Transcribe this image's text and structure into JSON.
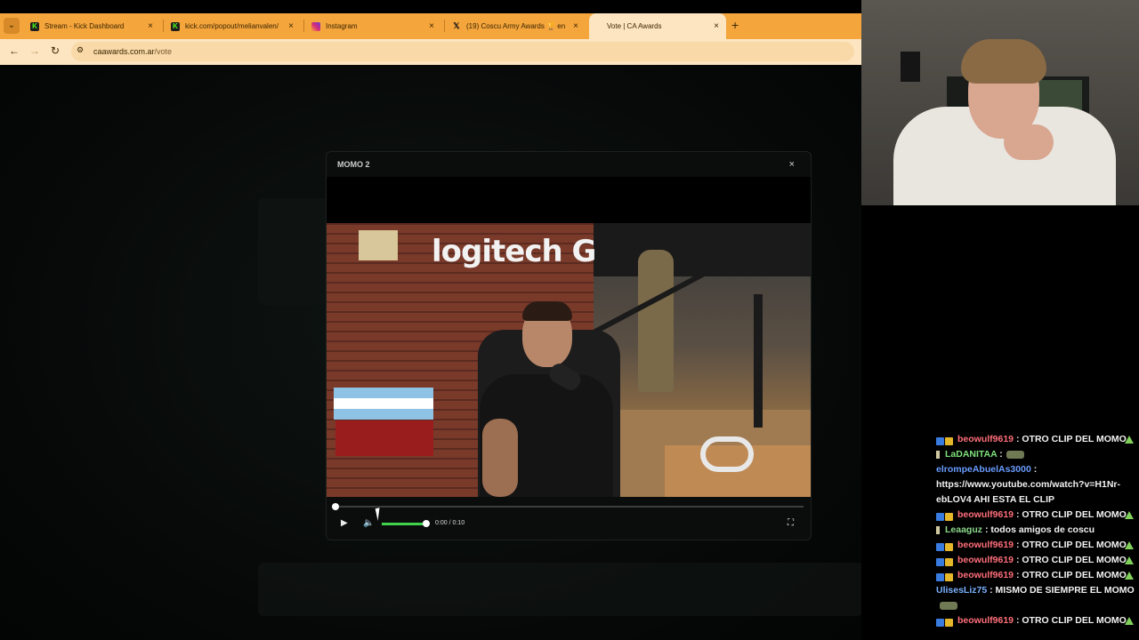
{
  "browser": {
    "tabs": [
      {
        "label": "Stream - Kick Dashboard",
        "favicon": "kick-icon",
        "active": false
      },
      {
        "label": "kick.com/popout/melianvalen/",
        "favicon": "kick-icon",
        "active": false
      },
      {
        "label": "Instagram",
        "favicon": "instagram-icon",
        "active": false
      },
      {
        "label": "(19) Coscu Army Awards 🏆 en",
        "favicon": "x-icon",
        "active": false
      },
      {
        "label": "Vote | CA Awards",
        "favicon": "",
        "active": true
      }
    ],
    "close_glyph": "×",
    "newtab_glyph": "+",
    "menu_glyph": "⌄",
    "url_domain": "caawards.com.ar",
    "url_path": "/vote",
    "nav": {
      "back": "←",
      "forward": "→",
      "reload": "↻",
      "site_info": "⚙"
    }
  },
  "modal": {
    "title": "MOMO 2",
    "close": "×",
    "video_logo": "logitech G",
    "player": {
      "play": "▶",
      "volume": "🔈",
      "time": "0:00 / 0:10",
      "fullscreen": "⛶",
      "progress": 0.0,
      "volume_level": 1.0
    }
  },
  "chat": {
    "messages": [
      {
        "user": "beowulf9619",
        "user_color": "#ff6e7a",
        "text": ": OTRO CLIP DEL MOMO",
        "badges": "double",
        "trail": true
      },
      {
        "user": "LaDANITAA",
        "user_color": "#7fe07a",
        "text": ":",
        "badges": "single",
        "emote": true
      },
      {
        "user": "elrompeAbuelAs3000",
        "user_color": "#6a9cff",
        "text": ":",
        "badges": "none"
      },
      {
        "user": "",
        "user_color": "#f2f2f2",
        "text": "https://www.youtube.com/watch?v=H1Nr-ebLOV4 AHI ESTA EL CLIP",
        "badges": "none"
      },
      {
        "user": "beowulf9619",
        "user_color": "#ff6e7a",
        "text": ": OTRO CLIP DEL MOMO",
        "badges": "double",
        "trail": true
      },
      {
        "user": "Leaaguz",
        "user_color": "#8bd68b",
        "text": ": todos amigos de coscu",
        "badges": "single"
      },
      {
        "user": "beowulf9619",
        "user_color": "#ff6e7a",
        "text": ": OTRO CLIP DEL MOMO",
        "badges": "double",
        "trail": true
      },
      {
        "user": "beowulf9619",
        "user_color": "#ff6e7a",
        "text": ": OTRO CLIP DEL MOMO",
        "badges": "double",
        "trail": true
      },
      {
        "user": "beowulf9619",
        "user_color": "#ff6e7a",
        "text": ": OTRO CLIP DEL MOMO",
        "badges": "double",
        "trail": true
      },
      {
        "user": "UlisesLiz75",
        "user_color": "#7ab0ff",
        "text": ": MISMO DE SIEMPRE EL MOMO",
        "badges": "none",
        "emote": true
      },
      {
        "user": "beowulf9619",
        "user_color": "#ff6e7a",
        "text": ": OTRO CLIP DEL MOMO",
        "badges": "double",
        "trail": true
      }
    ]
  },
  "colors": {
    "tab_strip": "#f4a53c",
    "address_bar": "#fde5c1",
    "volume_fill": "#3fd34b",
    "badge_blue": "#3a7be0",
    "badge_gold": "#e6b72a"
  }
}
